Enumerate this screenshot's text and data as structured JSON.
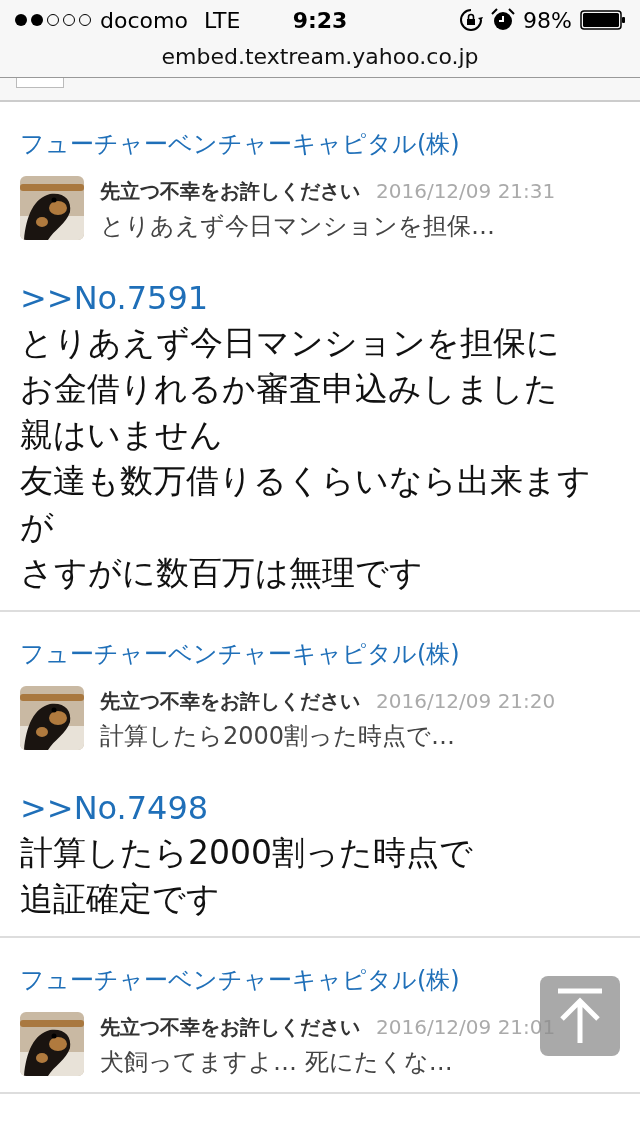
{
  "status_bar": {
    "carrier": "docomo",
    "network": "LTE",
    "time": "9:23",
    "battery": "98%"
  },
  "address_bar": {
    "url": "embed.textream.yahoo.co.jp"
  },
  "posts": [
    {
      "company": "フューチャーベンチャーキャピタル(株)",
      "author": "先立つ不幸をお許しください",
      "date": "2016/12/09 21:31",
      "preview": "とりあえず今日マンションを担保…",
      "reply_ref": ">>No.7591",
      "body": [
        "とりあえず今日マンションを担保に",
        "お金借りれるか審査申込みしました",
        "親はいません",
        "友達も数万借りるくらいなら出来ますが",
        "さすがに数百万は無理です"
      ]
    },
    {
      "company": "フューチャーベンチャーキャピタル(株)",
      "author": "先立つ不幸をお許しください",
      "date": "2016/12/09 21:20",
      "preview": "計算したら2000割った時点で…",
      "reply_ref": ">>No.7498",
      "body": [
        "計算したら2000割った時点で",
        "追証確定です"
      ]
    },
    {
      "company": "フューチャーベンチャーキャピタル(株)",
      "author": "先立つ不幸をお許しください",
      "date": "2016/12/09 21:01",
      "preview": "犬飼ってますよ… 死にたくな…"
    }
  ]
}
